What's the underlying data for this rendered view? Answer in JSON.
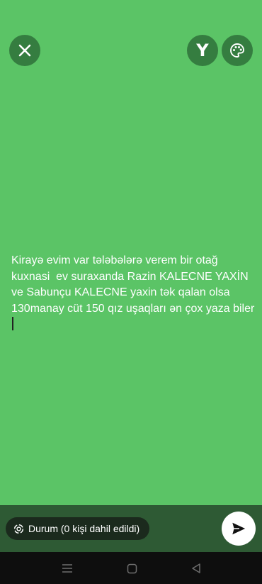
{
  "colors": {
    "background": "#5bc466",
    "button_bg": "#357d40",
    "bottom_bar": "#2e5a34",
    "chip_bg": "#1b2a1d",
    "nav_bar": "#0e0e0e"
  },
  "toolbar": {
    "close_icon": "close-icon",
    "font_button_label": "Y",
    "palette_icon": "palette-icon"
  },
  "status": {
    "text": "Kirayə evim var tələbələrə verem bir otağ kuxnasi  ev suraxanda Razin KALECNE YAXİN ve Sabunçu KALECNE yaxin tək qalan olsa 130manay cüt 150 qız uşaqları ən çox yaza biler"
  },
  "audience": {
    "label": "Durum (0 kişi dahil edildi)",
    "icon": "status-ring-icon"
  },
  "send": {
    "icon": "send-icon"
  },
  "nav": {
    "menu_icon": "menu-icon",
    "home_icon": "home-icon",
    "back_icon": "back-icon"
  }
}
